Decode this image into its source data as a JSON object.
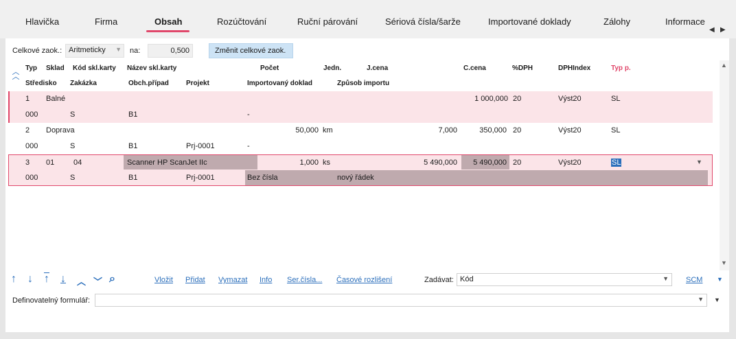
{
  "tabs": [
    {
      "label": "Hlavička"
    },
    {
      "label": "Firma"
    },
    {
      "label": "Obsah"
    },
    {
      "label": "Rozúčtování"
    },
    {
      "label": "Ruční párování"
    },
    {
      "label": "Sériová čísla/šarže"
    },
    {
      "label": "Importované doklady"
    },
    {
      "label": "Zálohy"
    },
    {
      "label": "Informace"
    }
  ],
  "topbar": {
    "total_discount_label": "Celkové zaok.:",
    "total_discount_mode": "Aritmeticky",
    "on_label": "na:",
    "on_value": "0,500",
    "change_button": "Změnit celkové zaok."
  },
  "headers": {
    "row1": [
      "Typ",
      "Sklad",
      "Kód skl.karty",
      "Název skl.karty",
      "Počet",
      "Jedn.",
      "J.cena",
      "C.cena",
      "%DPH",
      "DPHIndex",
      "Typ p."
    ],
    "row2": [
      "Středisko",
      "Zakázka",
      "Obch.případ",
      "Projekt",
      "Importovaný doklad",
      "Způsob importu"
    ]
  },
  "rows": [
    {
      "typ": "1",
      "sklad": "Balné",
      "kod": "",
      "nazev": "",
      "pocet": "",
      "jedn": "",
      "jcena": "",
      "ccena": "1 000,000",
      "dph": "20",
      "dphindex": "Výst20",
      "typp": "SL",
      "stredisko": "000",
      "zakazka": "S",
      "obch": "B1",
      "projekt": "",
      "importdoc": "-",
      "zpusob": ""
    },
    {
      "typ": "2",
      "sklad": "Doprava",
      "kod": "",
      "nazev": "",
      "pocet": "50,000",
      "jedn": "km",
      "jcena": "7,000",
      "ccena": "350,000",
      "dph": "20",
      "dphindex": "Výst20",
      "typp": "SL",
      "stredisko": "000",
      "zakazka": "S",
      "obch": "B1",
      "projekt": "Prj-0001",
      "importdoc": "-",
      "zpusob": ""
    },
    {
      "typ": "3",
      "sklad": "01",
      "kod": "04",
      "nazev": "Scanner HP ScanJet IIc",
      "pocet": "1,000",
      "jedn": "ks",
      "jcena": "5 490,000",
      "ccena": "5 490,000",
      "dph": "20",
      "dphindex": "Výst20",
      "typp": "SL",
      "stredisko": "000",
      "zakazka": "S",
      "obch": "B1",
      "projekt": "Prj-0001",
      "importdoc": "Bez čísla",
      "zpusob": "nový řádek"
    }
  ],
  "toolbar": {
    "links": [
      "Vložit",
      "Přidat",
      "Vymazat",
      "Info",
      "Ser.čísla...",
      "Časové rozlišení"
    ],
    "zadavat_label": "Zadávat:",
    "zadavat_value": "Kód",
    "scm": "SCM"
  },
  "form": {
    "label": "Definovatelný formulář:",
    "value": ""
  },
  "colors": {
    "accent": "#e0476a",
    "link": "#2a6ebb",
    "row_pink": "#fbe4e8",
    "button": "#cde3f5"
  }
}
